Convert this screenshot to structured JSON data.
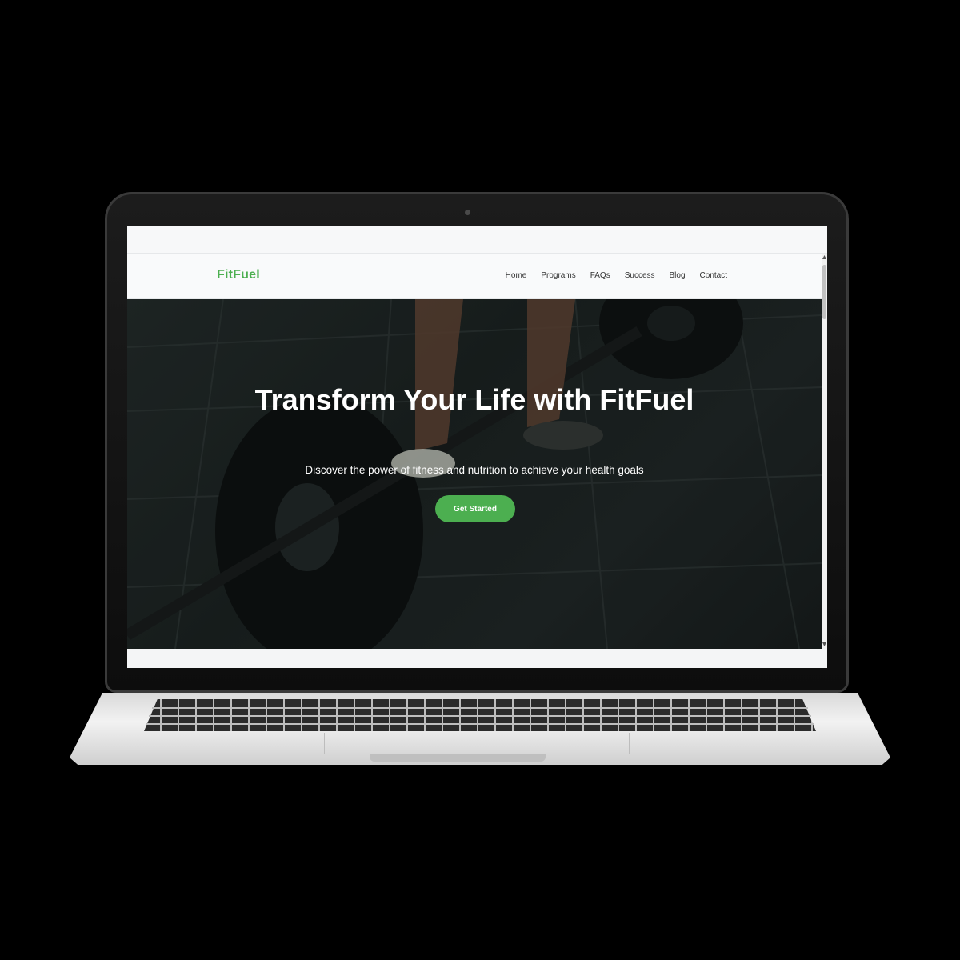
{
  "brand": {
    "name": "FitFuel",
    "accent": "#4caf50"
  },
  "nav": {
    "items": [
      {
        "label": "Home"
      },
      {
        "label": "Programs"
      },
      {
        "label": "FAQs"
      },
      {
        "label": "Success"
      },
      {
        "label": "Blog"
      },
      {
        "label": "Contact"
      }
    ]
  },
  "hero": {
    "title": "Transform Your Life with FitFuel",
    "subtitle": "Discover the power of fitness and nutrition to achieve your health goals",
    "cta_label": "Get Started"
  }
}
